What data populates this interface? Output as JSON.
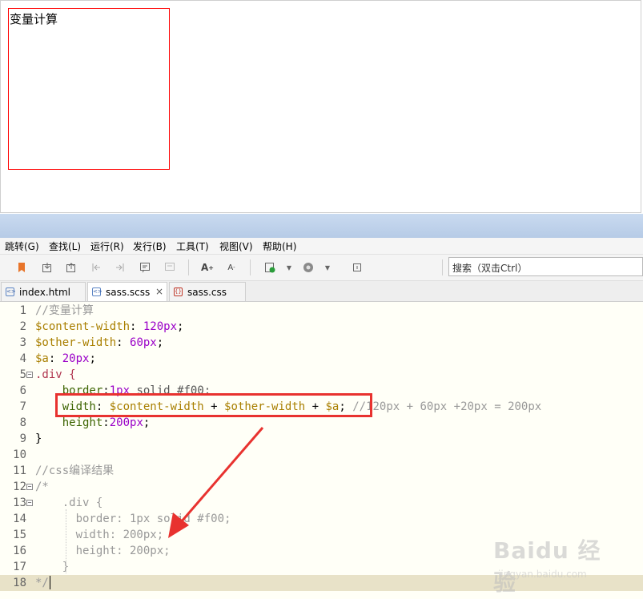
{
  "preview": {
    "box_text": "变量计算"
  },
  "menu": [
    "跳转(G)",
    "查找(L)",
    "运行(R)",
    "发行(B)",
    "工具(T)",
    "视图(V)",
    "帮助(H)"
  ],
  "toolbar": {
    "icons": [
      "bookmark-icon",
      "import-icon",
      "export-icon",
      "step-back-icon",
      "step-forward-icon",
      "comment-icon",
      "uncomment-icon",
      "font-increase-icon",
      "font-decrease-icon",
      "run-icon",
      "dropdown-icon",
      "browser-icon",
      "dropdown-icon",
      "info-icon"
    ],
    "font_up": "A",
    "font_down": "A",
    "search_placeholder": "搜索（双击Ctrl）"
  },
  "tabs": [
    {
      "label": "index.html",
      "icon": "<>"
    },
    {
      "label": "sass.scss",
      "icon": "<>",
      "active": true,
      "close": "×"
    },
    {
      "label": "sass.css",
      "icon": "{}"
    }
  ],
  "code": {
    "line_numbers": [
      "1",
      "2",
      "3",
      "4",
      "5",
      "6",
      "7",
      "8",
      "9",
      "10",
      "11",
      "12",
      "13",
      "14",
      "15",
      "16",
      "17",
      "18"
    ],
    "l1": "//变量计算",
    "l2_var": "$content-width",
    "l2_colon": ": ",
    "l2_num": "120px",
    "l2_end": ";",
    "l3_var": "$other-width",
    "l3_colon": ": ",
    "l3_num": "60px",
    "l3_end": ";",
    "l4_var": "$a",
    "l4_colon": ": ",
    "l4_num": "20px",
    "l4_end": ";",
    "l5": ".div {",
    "l6_prop": "    border",
    "l6_colon": ":",
    "l6_num": "1px",
    "l6_rest": " solid #f00;",
    "l7_prop": "    width",
    "l7_colon": ": ",
    "l7_v1": "$content-width",
    "l7_p1": " + ",
    "l7_v2": "$other-width",
    "l7_p2": " + ",
    "l7_v3": "$a",
    "l7_semi": ";",
    "l7_cmt": " //120px + 60px +20px = 200px",
    "l8_prop": "    height",
    "l8_colon": ":",
    "l8_num": "200px",
    "l8_end": ";",
    "l9": "}",
    "l10": "",
    "l11": "//css编译结果",
    "l12": "/*",
    "l13": "    .div {",
    "l14": "      border: 1px solid #f00;",
    "l15": "      width: 200px;",
    "l16": "      height: 200px;",
    "l17": "    }",
    "l18": "*/"
  },
  "watermark": {
    "logo": "Baidu 经验",
    "url": "jingyan.baidu.com"
  },
  "colors": {
    "highlight": "#e8322f",
    "preview_border": "#ff0000"
  }
}
